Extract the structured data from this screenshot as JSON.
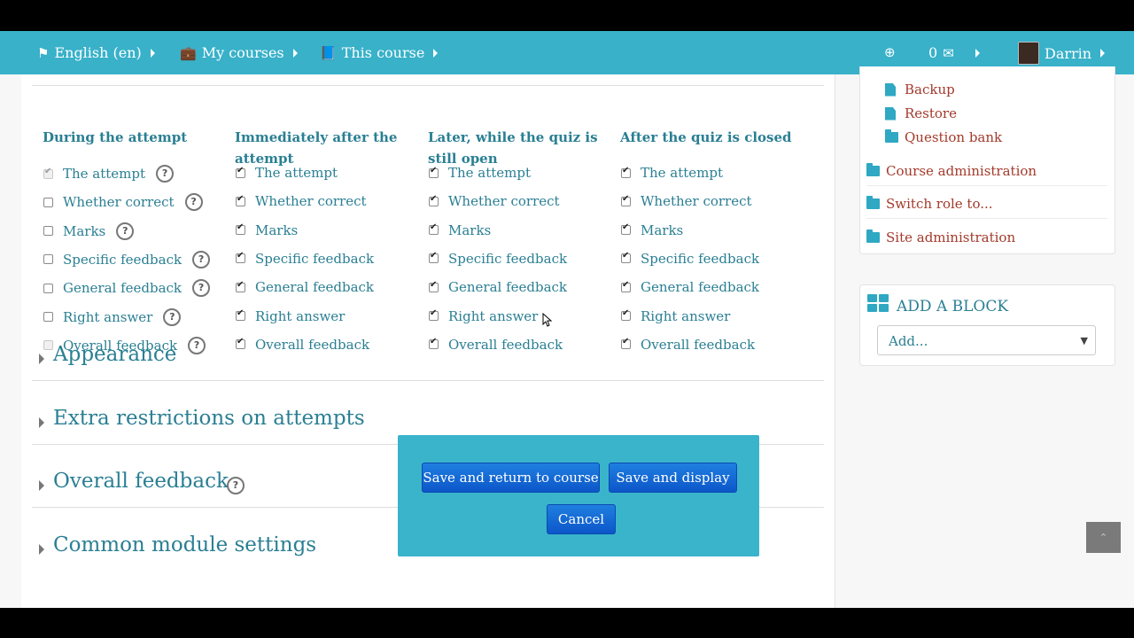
{
  "navbar": {
    "language": "English ‎(en)‎",
    "my_courses": "My courses",
    "this_course": "This course",
    "message_count": "0",
    "user_name": "Darrin"
  },
  "review_options": {
    "columns": [
      {
        "heading": "During the attempt",
        "items": [
          {
            "label": "The attempt",
            "checked": true,
            "disabled": true,
            "help": true
          },
          {
            "label": "Whether correct",
            "checked": false,
            "disabled": false,
            "help": true
          },
          {
            "label": "Marks",
            "checked": false,
            "disabled": false,
            "help": true
          },
          {
            "label": "Specific feedback",
            "checked": false,
            "disabled": false,
            "help": true
          },
          {
            "label": "General feedback",
            "checked": false,
            "disabled": false,
            "help": true
          },
          {
            "label": "Right answer",
            "checked": false,
            "disabled": false,
            "help": true
          },
          {
            "label": "Overall feedback",
            "checked": false,
            "disabled": true,
            "help": true
          }
        ]
      },
      {
        "heading": "Immediately after the attempt",
        "items": [
          {
            "label": "The attempt",
            "checked": true
          },
          {
            "label": "Whether correct",
            "checked": true
          },
          {
            "label": "Marks",
            "checked": true
          },
          {
            "label": "Specific feedback",
            "checked": true
          },
          {
            "label": "General feedback",
            "checked": true
          },
          {
            "label": "Right answer",
            "checked": true
          },
          {
            "label": "Overall feedback",
            "checked": true
          }
        ]
      },
      {
        "heading": "Later, while the quiz is still open",
        "items": [
          {
            "label": "The attempt",
            "checked": true
          },
          {
            "label": "Whether correct",
            "checked": true
          },
          {
            "label": "Marks",
            "checked": true
          },
          {
            "label": "Specific feedback",
            "checked": true
          },
          {
            "label": "General feedback",
            "checked": true
          },
          {
            "label": "Right answer",
            "checked": true
          },
          {
            "label": "Overall feedback",
            "checked": true
          }
        ]
      },
      {
        "heading": "After the quiz is closed",
        "items": [
          {
            "label": "The attempt",
            "checked": true
          },
          {
            "label": "Whether correct",
            "checked": true
          },
          {
            "label": "Marks",
            "checked": true
          },
          {
            "label": "Specific feedback",
            "checked": true
          },
          {
            "label": "General feedback",
            "checked": true
          },
          {
            "label": "Right answer",
            "checked": true
          },
          {
            "label": "Overall feedback",
            "checked": true
          }
        ]
      }
    ]
  },
  "sections": [
    {
      "label": "Appearance",
      "help": false
    },
    {
      "label": "Extra restrictions on attempts",
      "help": false
    },
    {
      "label": "Overall feedback",
      "help": true
    },
    {
      "label": "Common module settings",
      "help": false
    }
  ],
  "sidebar": {
    "files": [
      "Backup",
      "Restore"
    ],
    "question_bank": "Question bank",
    "course_administration": "Course administration",
    "switch_role": "Switch role to...",
    "site_administration": "Site administration",
    "add_block_title": "ADD A BLOCK",
    "add_select_value": "Add..."
  },
  "actions": {
    "save_return": "Save and return to course",
    "save_display": "Save and display",
    "cancel": "Cancel"
  },
  "colors": {
    "navbar": "#38b1c9",
    "link": "#2a7f93",
    "admin_link": "#a33a2b",
    "button": "#0c56c9"
  }
}
